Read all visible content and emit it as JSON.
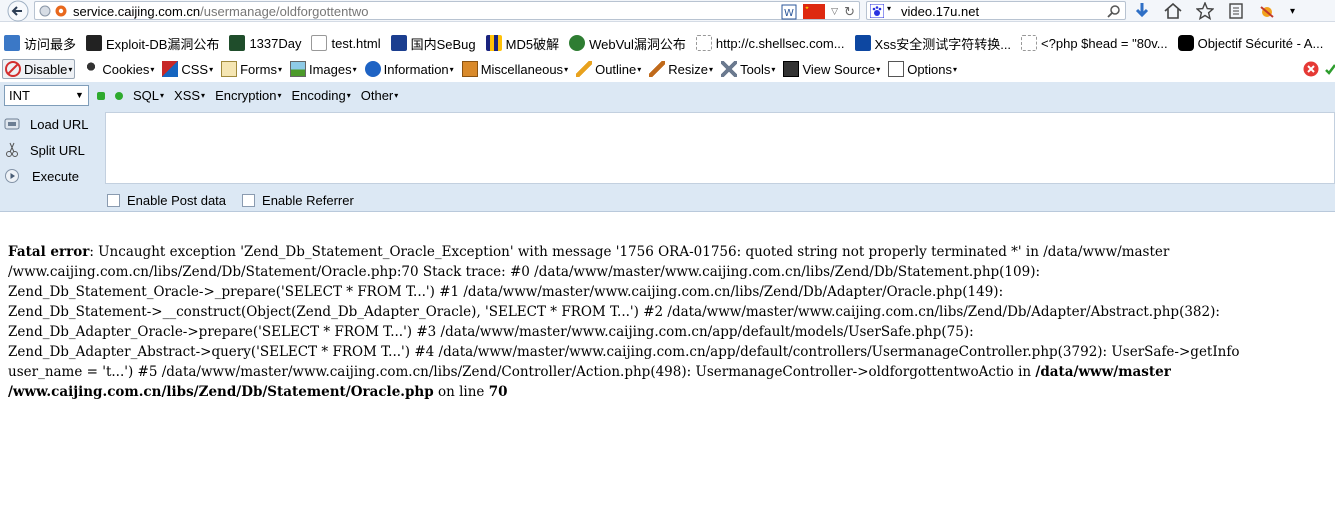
{
  "nav": {
    "url_host": "service.caijing.com.cn",
    "url_path": "/usermanage/oldforgottentwo",
    "search_text": "video.17u.net"
  },
  "bookmarks": [
    {
      "label": "访问最多",
      "icon": "bookmark-folder-icon"
    },
    {
      "label": "Exploit-DB漏洞公布",
      "icon": "exploit-db-icon"
    },
    {
      "label": "1337Day",
      "icon": "1337day-icon"
    },
    {
      "label": "test.html",
      "icon": "page-icon"
    },
    {
      "label": "国内SeBug",
      "icon": "sebug-icon"
    },
    {
      "label": "MD5破解",
      "icon": "md5-icon"
    },
    {
      "label": "WebVul漏洞公布",
      "icon": "webvul-icon"
    },
    {
      "label": "http://c.shellsec.com...",
      "icon": "page-icon"
    },
    {
      "label": "Xss安全测试字符转换...",
      "icon": "xss-icon"
    },
    {
      "label": "<?php $head = \"80v...",
      "icon": "page-icon"
    },
    {
      "label": "Objectif Sécurité - A...",
      "icon": "objectif-icon"
    }
  ],
  "devbar": {
    "disable": "Disable",
    "cookies": "Cookies",
    "css": "CSS",
    "forms": "Forms",
    "images": "Images",
    "information": "Information",
    "miscellaneous": "Miscellaneous",
    "outline": "Outline",
    "resize": "Resize",
    "tools": "Tools",
    "view_source": "View Source",
    "options": "Options"
  },
  "hackbar": {
    "select_value": "INT",
    "menu": {
      "sql": "SQL",
      "xss": "XSS",
      "encryption": "Encryption",
      "encoding": "Encoding",
      "other": "Other"
    },
    "load_url": "Load URL",
    "split_url": "Split URL",
    "execute": "Execute",
    "enable_post": "Enable Post data",
    "enable_referrer": "Enable Referrer"
  },
  "error": {
    "label": "Fatal error",
    "line1": ": Uncaught exception 'Zend_Db_Statement_Oracle_Exception' with message '1756 ORA-01756: quoted string not properly terminated *' in /data/www/master",
    "line2": "/www.caijing.com.cn/libs/Zend/Db/Statement/Oracle.php:70 Stack trace: #0 /data/www/master/www.caijing.com.cn/libs/Zend/Db/Statement.php(109):",
    "line3": "Zend_Db_Statement_Oracle->_prepare('SELECT * FROM T...') #1 /data/www/master/www.caijing.com.cn/libs/Zend/Db/Adapter/Oracle.php(149):",
    "line4": "Zend_Db_Statement->__construct(Object(Zend_Db_Adapter_Oracle), 'SELECT * FROM T...') #2 /data/www/master/www.caijing.com.cn/libs/Zend/Db/Adapter/Abstract.php(382):",
    "line5": "Zend_Db_Adapter_Oracle->prepare('SELECT * FROM T...') #3 /data/www/master/www.caijing.com.cn/app/default/models/UserSafe.php(75):",
    "line6": "Zend_Db_Adapter_Abstract->query('SELECT * FROM T...') #4 /data/www/master/www.caijing.com.cn/app/default/controllers/UsermanageController.php(3792): UserSafe->getInfo",
    "line7_pre": "user_name = 't...') #5 /data/www/master/www.caijing.com.cn/libs/Zend/Controller/Action.php(498): UsermanageController->oldforgottentwoActio in ",
    "line7_bold": "/data/www/master",
    "line8_bold": "/www.caijing.com.cn/libs/Zend/Db/Statement/Oracle.php",
    "line8_mid": " on line ",
    "line8_num": "70"
  }
}
